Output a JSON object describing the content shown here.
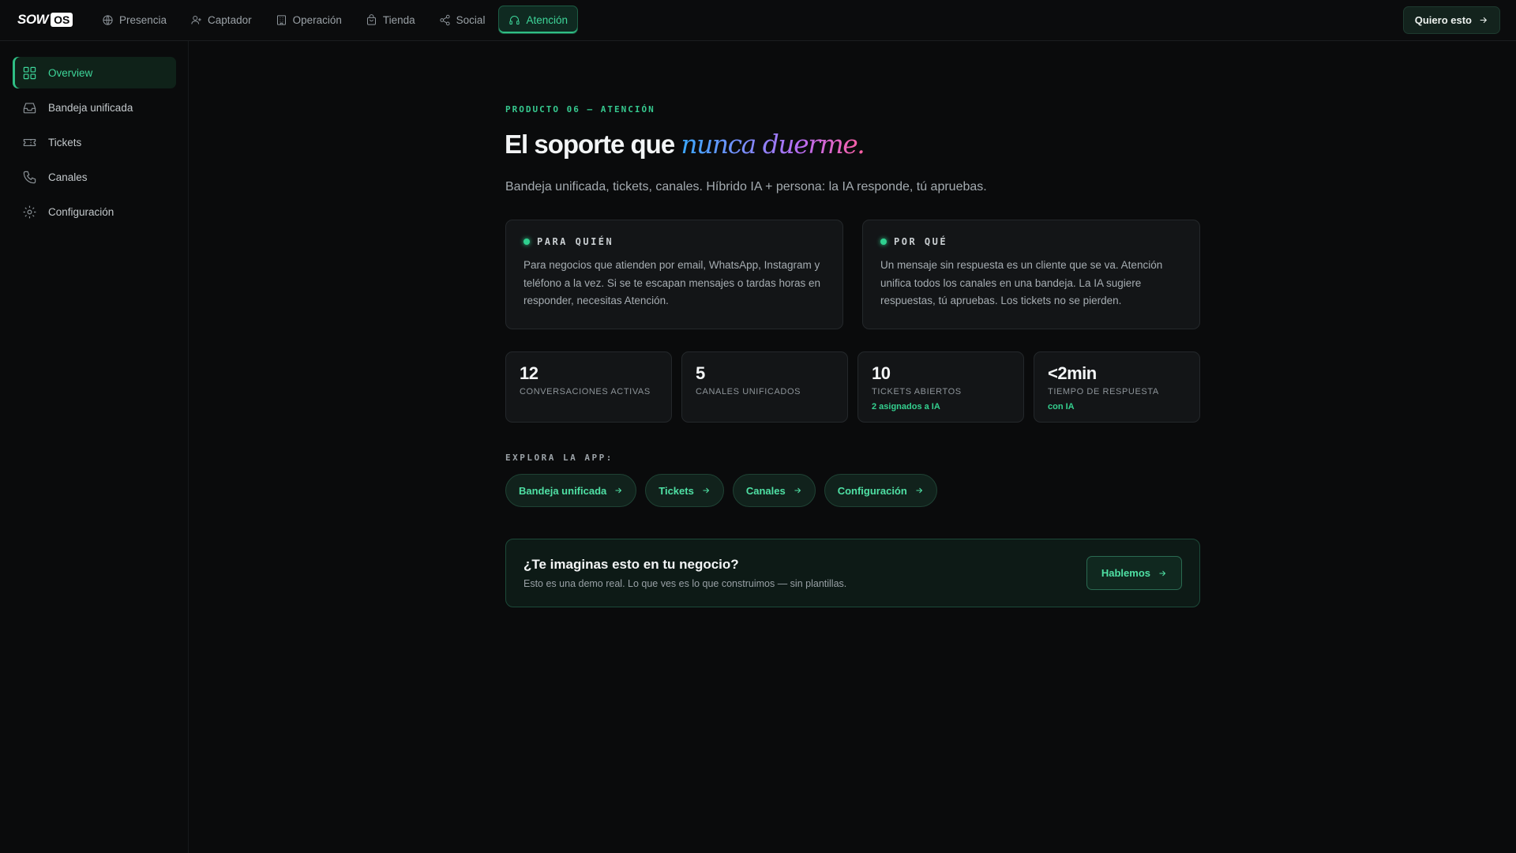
{
  "app": {
    "logo_word": "SOW",
    "logo_box": "OS"
  },
  "topnav": {
    "items": [
      {
        "label": "Presencia",
        "icon": "globe-icon"
      },
      {
        "label": "Captador",
        "icon": "user-plus-icon"
      },
      {
        "label": "Operación",
        "icon": "building-icon"
      },
      {
        "label": "Tienda",
        "icon": "shopping-bag-icon"
      },
      {
        "label": "Social",
        "icon": "share-icon"
      },
      {
        "label": "Atención",
        "icon": "headset-icon",
        "active": true
      }
    ],
    "cta_label": "Quiero esto"
  },
  "sidebar": {
    "items": [
      {
        "label": "Overview",
        "icon": "grid-icon",
        "active": true
      },
      {
        "label": "Bandeja unificada",
        "icon": "inbox-icon"
      },
      {
        "label": "Tickets",
        "icon": "ticket-icon"
      },
      {
        "label": "Canales",
        "icon": "phone-icon"
      },
      {
        "label": "Configuración",
        "icon": "gear-icon"
      }
    ]
  },
  "hero": {
    "eyebrow": "PRODUCTO 06 — ATENCIÓN",
    "title_prefix": "El soporte que ",
    "title_accent": "nunca duerme.",
    "subtitle": "Bandeja unificada, tickets, canales. Híbrido IA + persona: la IA responde, tú apruebas."
  },
  "cards": [
    {
      "label": "PARA QUIÉN",
      "body": "Para negocios que atienden por email, WhatsApp, Instagram y teléfono a la vez. Si se te escapan mensajes o tardas horas en responder, necesitas Atención."
    },
    {
      "label": "POR QUÉ",
      "body": "Un mensaje sin respuesta es un cliente que se va. Atención unifica todos los canales en una bandeja. La IA sugiere respuestas, tú apruebas. Los tickets no se pierden."
    }
  ],
  "stats": [
    {
      "value": "12",
      "label": "CONVERSACIONES ACTIVAS",
      "note": ""
    },
    {
      "value": "5",
      "label": "CANALES UNIFICADOS",
      "note": ""
    },
    {
      "value": "10",
      "label": "TICKETS ABIERTOS",
      "note": "2 asignados a IA"
    },
    {
      "value": "<2min",
      "label": "TIEMPO DE RESPUESTA",
      "note": "con IA"
    }
  ],
  "explore": {
    "label": "EXPLORA LA APP:",
    "links": [
      "Bandeja unificada",
      "Tickets",
      "Canales",
      "Configuración"
    ]
  },
  "banner": {
    "title": "¿Te imaginas esto en tu negocio?",
    "subtitle": "Esto es una demo real. Lo que ves es lo que construimos — sin plantillas.",
    "button_label": "Hablemos"
  },
  "colors": {
    "accent": "#2fbf85",
    "background": "#0a0b0c",
    "card": "#131517"
  }
}
